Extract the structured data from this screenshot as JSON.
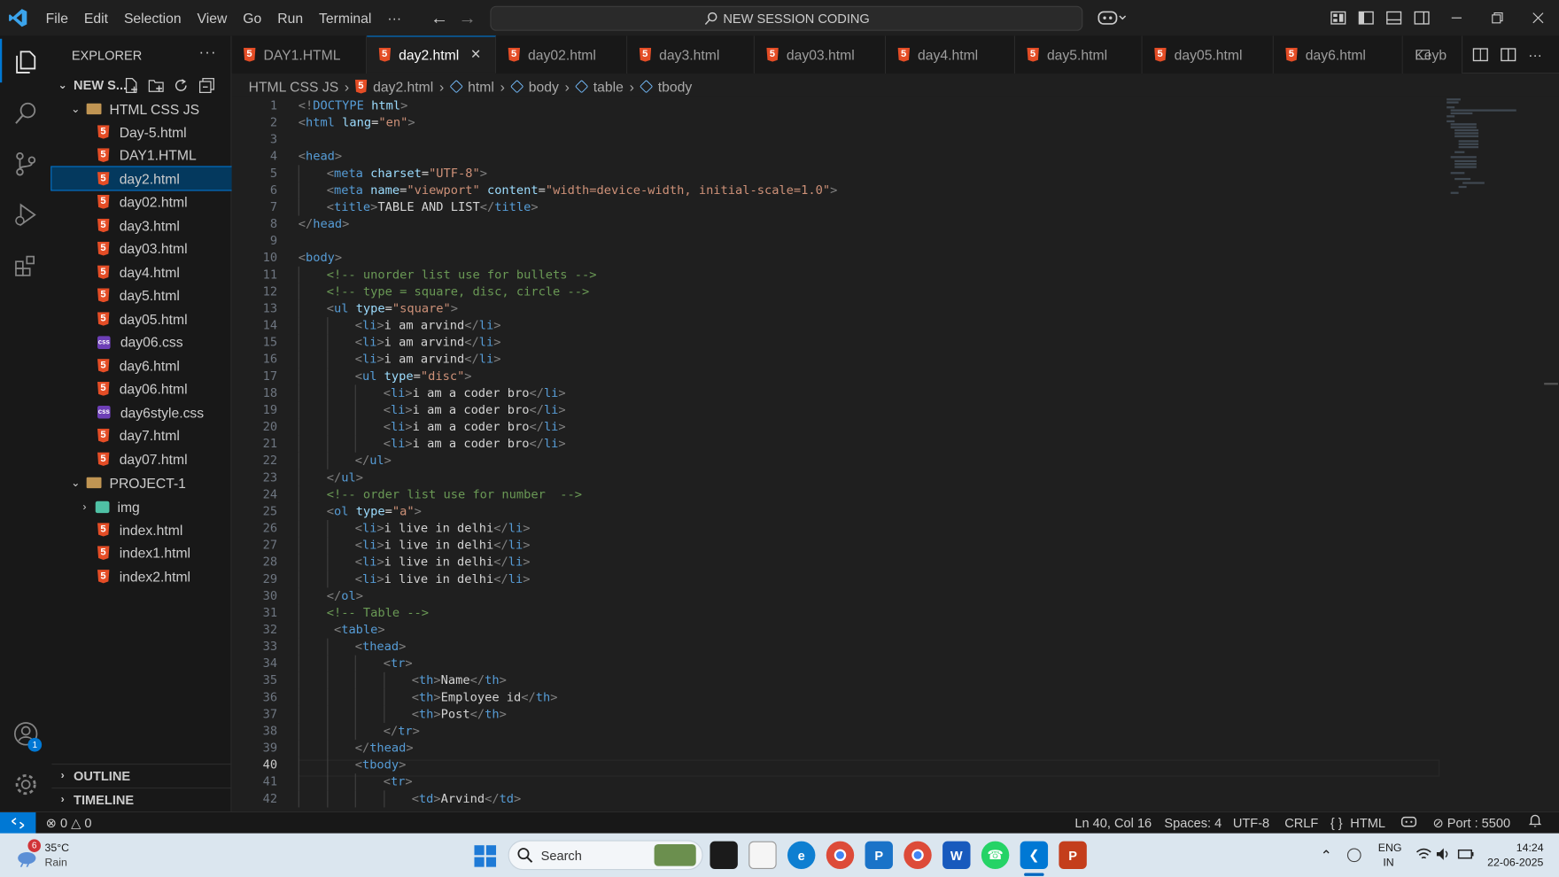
{
  "menu": {
    "file": "File",
    "edit": "Edit",
    "selection": "Selection",
    "view": "View",
    "go": "Go",
    "run": "Run",
    "terminal": "Terminal",
    "more": "···"
  },
  "command_center": {
    "label": "NEW SESSION CODING"
  },
  "explorer": {
    "title": "EXPLORER",
    "workspace": "NEW S...",
    "folder1": "HTML CSS JS",
    "folder2": "PROJECT-1",
    "files1": [
      {
        "name": "Day-5.html",
        "type": "html"
      },
      {
        "name": "DAY1.HTML",
        "type": "html"
      },
      {
        "name": "day2.html",
        "type": "html",
        "selected": true
      },
      {
        "name": "day02.html",
        "type": "html"
      },
      {
        "name": "day3.html",
        "type": "html"
      },
      {
        "name": "day03.html",
        "type": "html"
      },
      {
        "name": "day4.html",
        "type": "html"
      },
      {
        "name": "day5.html",
        "type": "html"
      },
      {
        "name": "day05.html",
        "type": "html"
      },
      {
        "name": "day06.css",
        "type": "css"
      },
      {
        "name": "day6.html",
        "type": "html"
      },
      {
        "name": "day06.html",
        "type": "html"
      },
      {
        "name": "day6style.css",
        "type": "css"
      },
      {
        "name": "day7.html",
        "type": "html"
      },
      {
        "name": "day07.html",
        "type": "html"
      }
    ],
    "img_folder": "img",
    "files2": [
      {
        "name": "index.html"
      },
      {
        "name": "index1.html"
      },
      {
        "name": "index2.html"
      }
    ],
    "outline": "OUTLINE",
    "timeline": "TIMELINE"
  },
  "tabs": [
    {
      "label": "DAY1.HTML"
    },
    {
      "label": "day2.html",
      "active": true
    },
    {
      "label": "day02.html"
    },
    {
      "label": "day3.html"
    },
    {
      "label": "day03.html"
    },
    {
      "label": "day4.html"
    },
    {
      "label": "day5.html"
    },
    {
      "label": "day05.html"
    },
    {
      "label": "day6.html"
    },
    {
      "label": "Keyb"
    }
  ],
  "breadcrumb": [
    "HTML CSS JS",
    "day2.html",
    "html",
    "body",
    "table",
    "tbody"
  ],
  "editor": {
    "current_line": 40,
    "lines": [
      {
        "n": "1",
        "i": 0,
        "h": "<span class='g'>&lt;!</span><span class='t'>DOCTYPE</span> <span class='a'>html</span><span class='g'>&gt;</span>"
      },
      {
        "n": "2",
        "i": 0,
        "h": "<span class='g'>&lt;</span><span class='t'>html</span> <span class='a'>lang</span>=<span class='s'>\"en\"</span><span class='g'>&gt;</span>"
      },
      {
        "n": "3",
        "i": 0,
        "h": ""
      },
      {
        "n": "4",
        "i": 0,
        "h": "<span class='g'>&lt;</span><span class='t'>head</span><span class='g'>&gt;</span>"
      },
      {
        "n": "5",
        "i": 1,
        "h": "<span class='g'>&lt;</span><span class='t'>meta</span> <span class='a'>charset</span>=<span class='s'>\"UTF-8\"</span><span class='g'>&gt;</span>"
      },
      {
        "n": "6",
        "i": 1,
        "h": "<span class='g'>&lt;</span><span class='t'>meta</span> <span class='a'>name</span>=<span class='s'>\"viewport\"</span> <span class='a'>content</span>=<span class='s'>\"width=device-width, initial-scale=1.0\"</span><span class='g'>&gt;</span>"
      },
      {
        "n": "7",
        "i": 1,
        "h": "<span class='g'>&lt;</span><span class='t'>title</span><span class='g'>&gt;</span>TABLE AND LIST<span class='g'>&lt;/</span><span class='t'>title</span><span class='g'>&gt;</span>"
      },
      {
        "n": "8",
        "i": 0,
        "h": "<span class='g'>&lt;/</span><span class='t'>head</span><span class='g'>&gt;</span>"
      },
      {
        "n": "9",
        "i": 0,
        "h": ""
      },
      {
        "n": "10",
        "i": 0,
        "h": "<span class='g'>&lt;</span><span class='t'>body</span><span class='g'>&gt;</span>"
      },
      {
        "n": "11",
        "i": 1,
        "h": "<span class='c'>&lt;!-- unorder list use for bullets --&gt;</span>"
      },
      {
        "n": "12",
        "i": 1,
        "h": "<span class='c'>&lt;!-- type = square, disc, circle --&gt;</span>"
      },
      {
        "n": "13",
        "i": 1,
        "h": "<span class='g'>&lt;</span><span class='t'>ul</span> <span class='a'>type</span>=<span class='s'>\"square\"</span><span class='g'>&gt;</span>"
      },
      {
        "n": "14",
        "i": 2,
        "h": "<span class='g'>&lt;</span><span class='t'>li</span><span class='g'>&gt;</span>i am arvind<span class='g'>&lt;/</span><span class='t'>li</span><span class='g'>&gt;</span>"
      },
      {
        "n": "15",
        "i": 2,
        "h": "<span class='g'>&lt;</span><span class='t'>li</span><span class='g'>&gt;</span>i am arvind<span class='g'>&lt;/</span><span class='t'>li</span><span class='g'>&gt;</span>"
      },
      {
        "n": "16",
        "i": 2,
        "h": "<span class='g'>&lt;</span><span class='t'>li</span><span class='g'>&gt;</span>i am arvind<span class='g'>&lt;/</span><span class='t'>li</span><span class='g'>&gt;</span>"
      },
      {
        "n": "17",
        "i": 2,
        "h": "<span class='g'>&lt;</span><span class='t'>ul</span> <span class='a'>type</span>=<span class='s'>\"disc\"</span><span class='g'>&gt;</span>"
      },
      {
        "n": "18",
        "i": 3,
        "h": "<span class='g'>&lt;</span><span class='t'>li</span><span class='g'>&gt;</span>i am a coder bro<span class='g'>&lt;/</span><span class='t'>li</span><span class='g'>&gt;</span>"
      },
      {
        "n": "19",
        "i": 3,
        "h": "<span class='g'>&lt;</span><span class='t'>li</span><span class='g'>&gt;</span>i am a coder bro<span class='g'>&lt;/</span><span class='t'>li</span><span class='g'>&gt;</span>"
      },
      {
        "n": "20",
        "i": 3,
        "h": "<span class='g'>&lt;</span><span class='t'>li</span><span class='g'>&gt;</span>i am a coder bro<span class='g'>&lt;/</span><span class='t'>li</span><span class='g'>&gt;</span>"
      },
      {
        "n": "21",
        "i": 3,
        "h": "<span class='g'>&lt;</span><span class='t'>li</span><span class='g'>&gt;</span>i am a coder bro<span class='g'>&lt;/</span><span class='t'>li</span><span class='g'>&gt;</span>"
      },
      {
        "n": "22",
        "i": 2,
        "h": "<span class='g'>&lt;/</span><span class='t'>ul</span><span class='g'>&gt;</span>"
      },
      {
        "n": "23",
        "i": 1,
        "h": "<span class='g'>&lt;/</span><span class='t'>ul</span><span class='g'>&gt;</span>"
      },
      {
        "n": "24",
        "i": 1,
        "h": "<span class='c'>&lt;!-- order list use for number  --&gt;</span>"
      },
      {
        "n": "25",
        "i": 1,
        "h": "<span class='g'>&lt;</span><span class='t'>ol</span> <span class='a'>type</span>=<span class='s'>\"a\"</span><span class='g'>&gt;</span>"
      },
      {
        "n": "26",
        "i": 2,
        "h": "<span class='g'>&lt;</span><span class='t'>li</span><span class='g'>&gt;</span>i live in delhi<span class='g'>&lt;/</span><span class='t'>li</span><span class='g'>&gt;</span>"
      },
      {
        "n": "27",
        "i": 2,
        "h": "<span class='g'>&lt;</span><span class='t'>li</span><span class='g'>&gt;</span>i live in delhi<span class='g'>&lt;/</span><span class='t'>li</span><span class='g'>&gt;</span>"
      },
      {
        "n": "28",
        "i": 2,
        "h": "<span class='g'>&lt;</span><span class='t'>li</span><span class='g'>&gt;</span>i live in delhi<span class='g'>&lt;/</span><span class='t'>li</span><span class='g'>&gt;</span>"
      },
      {
        "n": "29",
        "i": 2,
        "h": "<span class='g'>&lt;</span><span class='t'>li</span><span class='g'>&gt;</span>i live in delhi<span class='g'>&lt;/</span><span class='t'>li</span><span class='g'>&gt;</span>"
      },
      {
        "n": "30",
        "i": 1,
        "h": "<span class='g'>&lt;/</span><span class='t'>ol</span><span class='g'>&gt;</span>"
      },
      {
        "n": "31",
        "i": 1,
        "h": "<span class='c'>&lt;!-- Table --&gt;</span>"
      },
      {
        "n": "32",
        "i": 1,
        "h": " <span class='g'>&lt;</span><span class='t'>table</span><span class='g'>&gt;</span>"
      },
      {
        "n": "33",
        "i": 2,
        "h": "<span class='g'>&lt;</span><span class='t'>thead</span><span class='g'>&gt;</span>"
      },
      {
        "n": "34",
        "i": 3,
        "h": "<span class='g'>&lt;</span><span class='t'>tr</span><span class='g'>&gt;</span>"
      },
      {
        "n": "35",
        "i": 4,
        "h": "<span class='g'>&lt;</span><span class='t'>th</span><span class='g'>&gt;</span>Name<span class='g'>&lt;/</span><span class='t'>th</span><span class='g'>&gt;</span>"
      },
      {
        "n": "36",
        "i": 4,
        "h": "<span class='g'>&lt;</span><span class='t'>th</span><span class='g'>&gt;</span>Employee id<span class='g'>&lt;/</span><span class='t'>th</span><span class='g'>&gt;</span>"
      },
      {
        "n": "37",
        "i": 4,
        "h": "<span class='g'>&lt;</span><span class='t'>th</span><span class='g'>&gt;</span>Post<span class='g'>&lt;/</span><span class='t'>th</span><span class='g'>&gt;</span>"
      },
      {
        "n": "38",
        "i": 3,
        "h": "<span class='g'>&lt;/</span><span class='t'>tr</span><span class='g'>&gt;</span>"
      },
      {
        "n": "39",
        "i": 2,
        "h": "<span class='g'>&lt;/</span><span class='t'>thead</span><span class='g'>&gt;</span>"
      },
      {
        "n": "40",
        "i": 2,
        "h": "<span class='g'>&lt;</span><span class='t'>tbody</span><span class='g'>&gt;</span>"
      },
      {
        "n": "41",
        "i": 3,
        "h": "<span class='g'>&lt;</span><span class='t'>tr</span><span class='g'>&gt;</span>"
      },
      {
        "n": "42",
        "i": 4,
        "h": "<span class='g'>&lt;</span><span class='t'>td</span><span class='g'>&gt;</span>Arvind<span class='g'>&lt;/</span><span class='t'>td</span><span class='g'>&gt;</span>"
      }
    ]
  },
  "status": {
    "errors": "0",
    "warnings": "0",
    "position": "Ln 40, Col 16",
    "spaces": "Spaces: 4",
    "encoding": "UTF-8",
    "eol": "CRLF",
    "language": "HTML",
    "port": "Port : 5500"
  },
  "taskbar": {
    "temp": "35°C",
    "weather": "Rain",
    "badge": "6",
    "search": "Search",
    "lang1": "ENG",
    "lang2": "IN",
    "time": "14:24",
    "date": "22-06-2025"
  },
  "accounts_badge": "1"
}
